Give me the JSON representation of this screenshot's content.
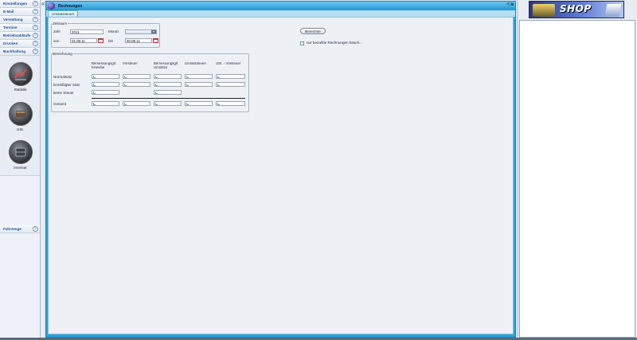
{
  "sidebar": {
    "items_top": [
      {
        "label": "Einstellungen"
      },
      {
        "label": "E-Mail"
      },
      {
        "label": "Verwaltung"
      },
      {
        "label": "Termine"
      },
      {
        "label": "Betriebsabläufe"
      },
      {
        "label": "Drucken"
      },
      {
        "label": "Buchhaltung"
      }
    ],
    "buchhaltung_icons": [
      {
        "label": "Statistik"
      },
      {
        "label": "USt."
      },
      {
        "label": "Inventar"
      }
    ],
    "items_bottom": [
      {
        "label": "Fahrzeuge"
      }
    ],
    "chevron_glyph": "»"
  },
  "window": {
    "title": "Rechnungen",
    "tab_label": "Umsatzsteuer",
    "collapse_left_glyph": "«",
    "collapse_right_glyph": "»",
    "window_btns": "⇱⇲"
  },
  "zeitraum": {
    "legend": "Zeitraum",
    "jahr_label": "Jahr",
    "jahr_value": "2011",
    "monat_label": "Monat",
    "monat_value": "",
    "von_label": "von",
    "von_value": "01.08.11",
    "bis_label": "bis",
    "bis_value": "30.08.11"
  },
  "berechnung": {
    "legend": "Berechnung",
    "columns": [
      "Bemessungsgrl. Erwerbe",
      "Vorsteuer",
      "Bemessungsgrl. Umsätze",
      "Umsatzsteuer",
      "USt. - Vorsteuer"
    ],
    "rows": [
      "Normalsatz",
      "Ermäßigter Satz",
      "keine Steuer",
      "Gesamt"
    ]
  },
  "actions": {
    "berechne_label": "Berechne",
    "paid_only_label": "nur bezahlte Rechnungen beach...",
    "paid_only_checked": false
  },
  "shop": {
    "banner_text": "SHOP"
  }
}
